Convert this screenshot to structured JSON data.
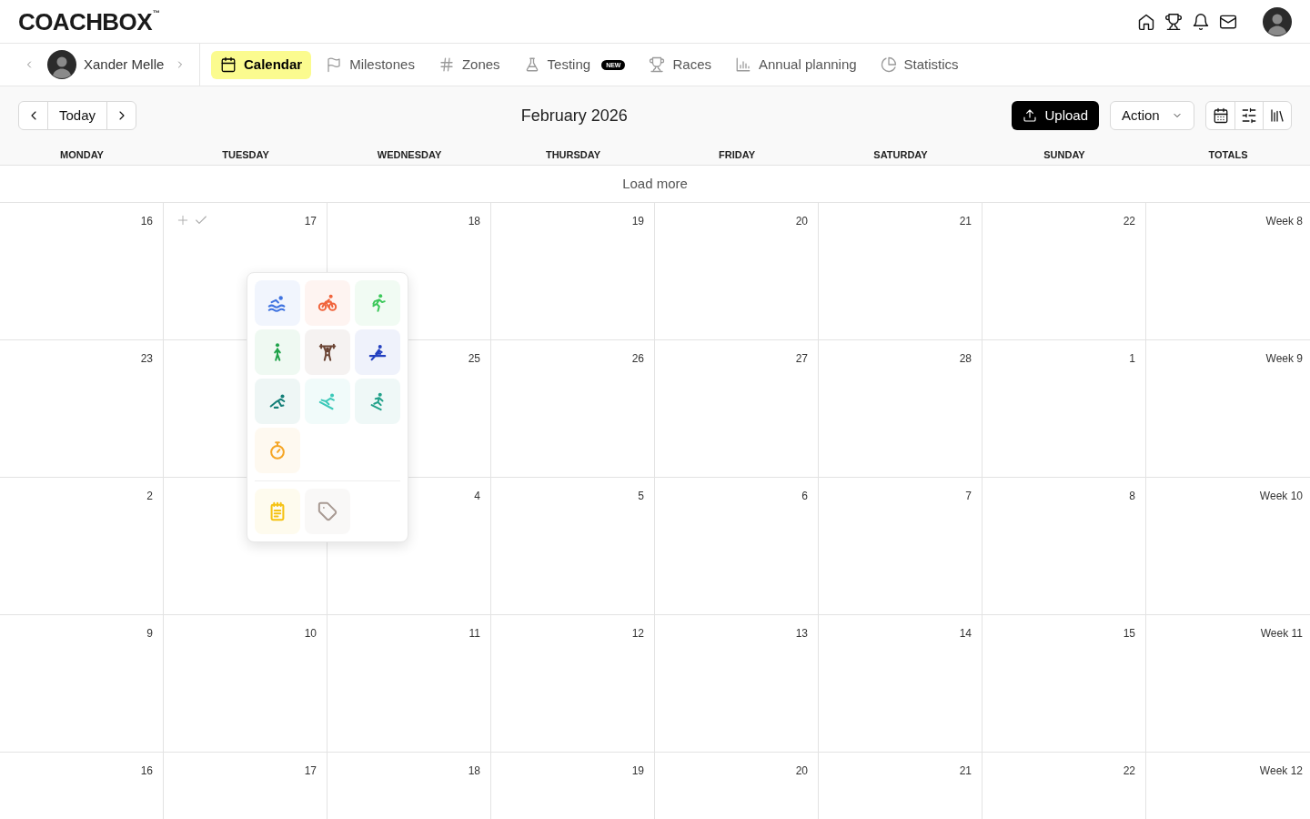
{
  "header": {
    "logo": "COACHBOX$^{™}$"
  },
  "athlete": {
    "name": "Xander Melle"
  },
  "tabs": [
    {
      "label": "Calendar",
      "kind": "calendar",
      "selected": true
    },
    {
      "label": "Milestones",
      "kind": "flag",
      "selected": false
    },
    {
      "label": "Zones",
      "kind": "hash",
      "selected": false
    },
    {
      "label": "Testing",
      "kind": "flask",
      "selected": false,
      "badge": "NEW"
    },
    {
      "label": "Races",
      "kind": "trophy",
      "selected": false
    },
    {
      "label": "Annual planning",
      "kind": "bars",
      "selected": false
    },
    {
      "label": "Statistics",
      "kind": "pie",
      "selected": false
    }
  ],
  "toolbar": {
    "today": "Today",
    "title": "February 2026",
    "upload": "Upload",
    "action": "Action"
  },
  "columns": [
    "MONDAY",
    "TUESDAY",
    "WEDNESDAY",
    "THURSDAY",
    "FRIDAY",
    "SATURDAY",
    "SUNDAY",
    "TOTALS"
  ],
  "load_more": "Load more",
  "weeks": [
    {
      "days": [
        {
          "label": "16",
          "hovered": false
        },
        {
          "label": "17",
          "hovered": true
        },
        {
          "label": "18",
          "hovered": false
        },
        {
          "label": "19",
          "hovered": false
        },
        {
          "label": "20",
          "hovered": false
        },
        {
          "label": "21",
          "hovered": false
        },
        {
          "label": "22",
          "hovered": false
        }
      ],
      "total": "Week 8"
    },
    {
      "days": [
        {
          "label": "23",
          "hovered": false
        },
        {
          "hovered": false
        },
        {
          "label": "25",
          "hovered": false
        },
        {
          "label": "26",
          "hovered": false
        },
        {
          "label": "27",
          "hovered": false
        },
        {
          "label": "28",
          "hovered": false
        },
        {
          "label": "1",
          "hovered": false
        }
      ],
      "total": "Week 9"
    },
    {
      "days": [
        {
          "label": "2",
          "hovered": false
        },
        {
          "hovered": false
        },
        {
          "label": "4",
          "hovered": false
        },
        {
          "label": "5",
          "hovered": false
        },
        {
          "label": "6",
          "hovered": false
        },
        {
          "label": "7",
          "hovered": false
        },
        {
          "label": "8",
          "hovered": false
        }
      ],
      "total": "Week 10"
    },
    {
      "days": [
        {
          "label": "9",
          "hovered": false
        },
        {
          "label": "10",
          "hovered": false
        },
        {
          "label": "11",
          "hovered": false
        },
        {
          "label": "12",
          "hovered": false
        },
        {
          "label": "13",
          "hovered": false
        },
        {
          "label": "14",
          "hovered": false
        },
        {
          "label": "15",
          "hovered": false
        }
      ],
      "total": "Week 11"
    },
    {
      "days": [
        {
          "label": "16",
          "hovered": false
        },
        {
          "label": "17",
          "hovered": false
        },
        {
          "label": "18",
          "hovered": false
        },
        {
          "label": "19",
          "hovered": false
        },
        {
          "label": "20",
          "hovered": false
        },
        {
          "label": "21",
          "hovered": false
        },
        {
          "label": "22",
          "hovered": false
        }
      ],
      "total": "Week 12"
    }
  ],
  "activity_menu": {
    "open": true,
    "activities": [
      {
        "kind": "swim",
        "color": "#3f73e0"
      },
      {
        "kind": "bike",
        "color": "#f0643c"
      },
      {
        "kind": "run",
        "color": "#3cc85a"
      },
      {
        "kind": "walk",
        "color": "#1fa34a"
      },
      {
        "kind": "strength",
        "color": "#6b4434"
      },
      {
        "kind": "rowing",
        "color": "#2340c0"
      },
      {
        "kind": "skate",
        "color": "#137f78"
      },
      {
        "kind": "ski",
        "color": "#3cc9b9"
      },
      {
        "kind": "snowboard",
        "color": "#22a18a"
      },
      {
        "kind": "stopwatch",
        "color": "#f5a524"
      }
    ],
    "extras": [
      {
        "kind": "note",
        "color": "#f5c211"
      },
      {
        "kind": "tag",
        "color": "#a89a93"
      }
    ]
  }
}
